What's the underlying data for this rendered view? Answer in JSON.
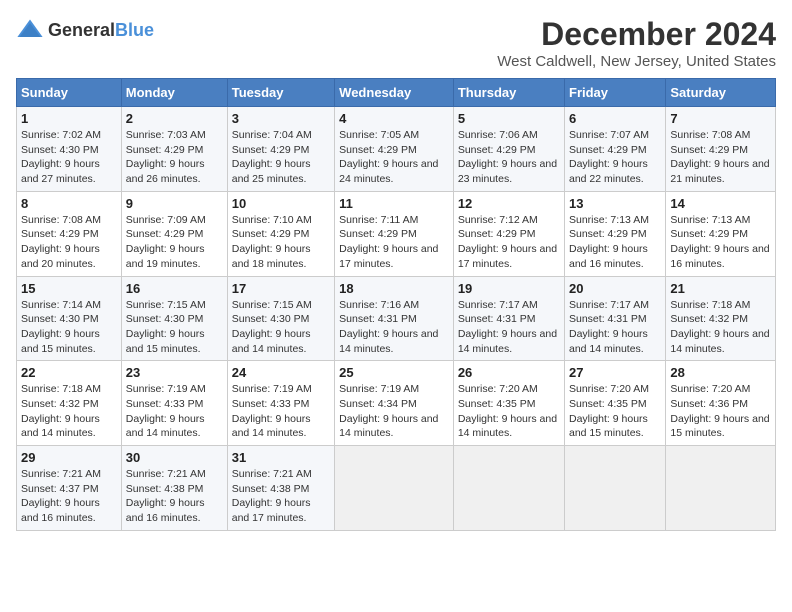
{
  "header": {
    "logo_general": "General",
    "logo_blue": "Blue",
    "month_title": "December 2024",
    "location": "West Caldwell, New Jersey, United States"
  },
  "days_of_week": [
    "Sunday",
    "Monday",
    "Tuesday",
    "Wednesday",
    "Thursday",
    "Friday",
    "Saturday"
  ],
  "weeks": [
    [
      {
        "day": "1",
        "sunrise": "7:02 AM",
        "sunset": "4:30 PM",
        "daylight": "9 hours and 27 minutes."
      },
      {
        "day": "2",
        "sunrise": "7:03 AM",
        "sunset": "4:29 PM",
        "daylight": "9 hours and 26 minutes."
      },
      {
        "day": "3",
        "sunrise": "7:04 AM",
        "sunset": "4:29 PM",
        "daylight": "9 hours and 25 minutes."
      },
      {
        "day": "4",
        "sunrise": "7:05 AM",
        "sunset": "4:29 PM",
        "daylight": "9 hours and 24 minutes."
      },
      {
        "day": "5",
        "sunrise": "7:06 AM",
        "sunset": "4:29 PM",
        "daylight": "9 hours and 23 minutes."
      },
      {
        "day": "6",
        "sunrise": "7:07 AM",
        "sunset": "4:29 PM",
        "daylight": "9 hours and 22 minutes."
      },
      {
        "day": "7",
        "sunrise": "7:08 AM",
        "sunset": "4:29 PM",
        "daylight": "9 hours and 21 minutes."
      }
    ],
    [
      {
        "day": "8",
        "sunrise": "7:08 AM",
        "sunset": "4:29 PM",
        "daylight": "9 hours and 20 minutes."
      },
      {
        "day": "9",
        "sunrise": "7:09 AM",
        "sunset": "4:29 PM",
        "daylight": "9 hours and 19 minutes."
      },
      {
        "day": "10",
        "sunrise": "7:10 AM",
        "sunset": "4:29 PM",
        "daylight": "9 hours and 18 minutes."
      },
      {
        "day": "11",
        "sunrise": "7:11 AM",
        "sunset": "4:29 PM",
        "daylight": "9 hours and 17 minutes."
      },
      {
        "day": "12",
        "sunrise": "7:12 AM",
        "sunset": "4:29 PM",
        "daylight": "9 hours and 17 minutes."
      },
      {
        "day": "13",
        "sunrise": "7:13 AM",
        "sunset": "4:29 PM",
        "daylight": "9 hours and 16 minutes."
      },
      {
        "day": "14",
        "sunrise": "7:13 AM",
        "sunset": "4:29 PM",
        "daylight": "9 hours and 16 minutes."
      }
    ],
    [
      {
        "day": "15",
        "sunrise": "7:14 AM",
        "sunset": "4:30 PM",
        "daylight": "9 hours and 15 minutes."
      },
      {
        "day": "16",
        "sunrise": "7:15 AM",
        "sunset": "4:30 PM",
        "daylight": "9 hours and 15 minutes."
      },
      {
        "day": "17",
        "sunrise": "7:15 AM",
        "sunset": "4:30 PM",
        "daylight": "9 hours and 14 minutes."
      },
      {
        "day": "18",
        "sunrise": "7:16 AM",
        "sunset": "4:31 PM",
        "daylight": "9 hours and 14 minutes."
      },
      {
        "day": "19",
        "sunrise": "7:17 AM",
        "sunset": "4:31 PM",
        "daylight": "9 hours and 14 minutes."
      },
      {
        "day": "20",
        "sunrise": "7:17 AM",
        "sunset": "4:31 PM",
        "daylight": "9 hours and 14 minutes."
      },
      {
        "day": "21",
        "sunrise": "7:18 AM",
        "sunset": "4:32 PM",
        "daylight": "9 hours and 14 minutes."
      }
    ],
    [
      {
        "day": "22",
        "sunrise": "7:18 AM",
        "sunset": "4:32 PM",
        "daylight": "9 hours and 14 minutes."
      },
      {
        "day": "23",
        "sunrise": "7:19 AM",
        "sunset": "4:33 PM",
        "daylight": "9 hours and 14 minutes."
      },
      {
        "day": "24",
        "sunrise": "7:19 AM",
        "sunset": "4:33 PM",
        "daylight": "9 hours and 14 minutes."
      },
      {
        "day": "25",
        "sunrise": "7:19 AM",
        "sunset": "4:34 PM",
        "daylight": "9 hours and 14 minutes."
      },
      {
        "day": "26",
        "sunrise": "7:20 AM",
        "sunset": "4:35 PM",
        "daylight": "9 hours and 14 minutes."
      },
      {
        "day": "27",
        "sunrise": "7:20 AM",
        "sunset": "4:35 PM",
        "daylight": "9 hours and 15 minutes."
      },
      {
        "day": "28",
        "sunrise": "7:20 AM",
        "sunset": "4:36 PM",
        "daylight": "9 hours and 15 minutes."
      }
    ],
    [
      {
        "day": "29",
        "sunrise": "7:21 AM",
        "sunset": "4:37 PM",
        "daylight": "9 hours and 16 minutes."
      },
      {
        "day": "30",
        "sunrise": "7:21 AM",
        "sunset": "4:38 PM",
        "daylight": "9 hours and 16 minutes."
      },
      {
        "day": "31",
        "sunrise": "7:21 AM",
        "sunset": "4:38 PM",
        "daylight": "9 hours and 17 minutes."
      },
      null,
      null,
      null,
      null
    ]
  ],
  "labels": {
    "sunrise_label": "Sunrise:",
    "sunset_label": "Sunset:",
    "daylight_label": "Daylight:"
  }
}
